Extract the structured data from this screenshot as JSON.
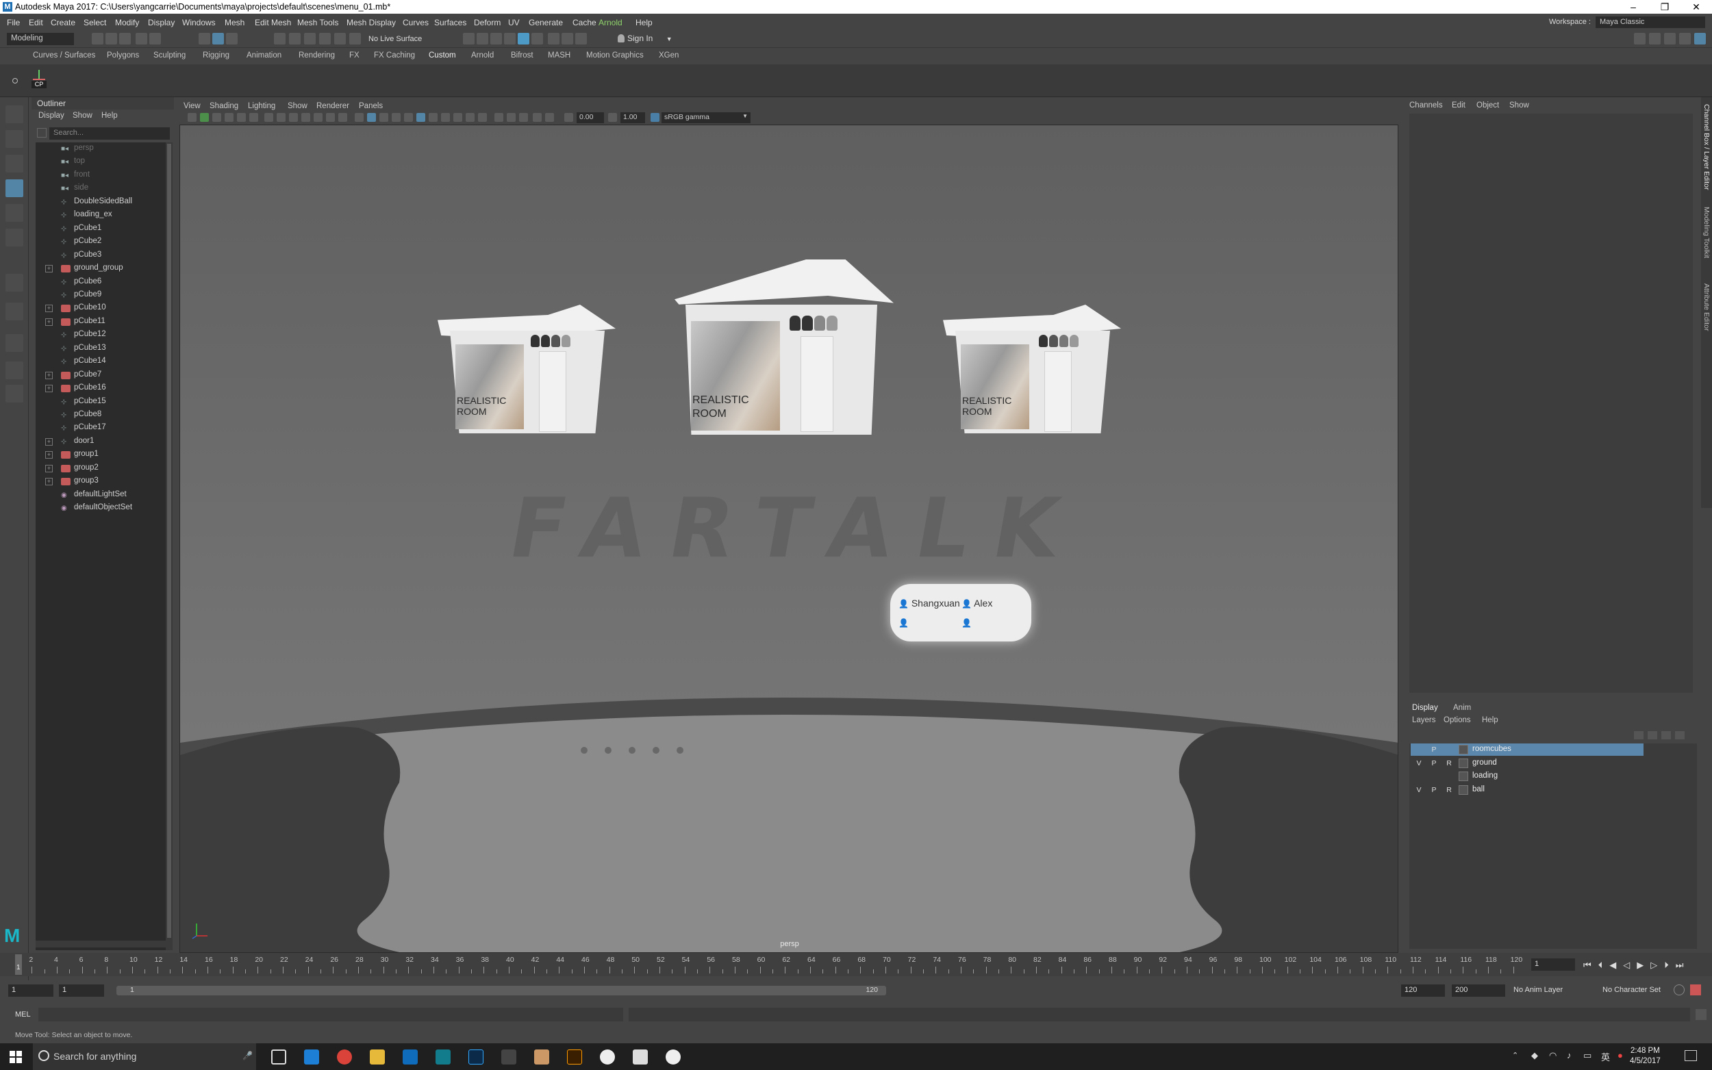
{
  "window": {
    "title": "Autodesk Maya 2017: C:\\Users\\yangcarrie\\Documents\\maya\\projects\\default\\scenes\\menu_01.mb*",
    "controls": [
      "–",
      "❐",
      "✕"
    ]
  },
  "menubar": {
    "items": [
      "File",
      "Edit",
      "Create",
      "Select",
      "Modify",
      "Display",
      "Windows",
      "Mesh",
      "Edit Mesh",
      "Mesh Tools",
      "Mesh Display",
      "Curves",
      "Surfaces",
      "Deform",
      "UV",
      "Generate",
      "Cache",
      "Arnold",
      "Help"
    ],
    "workspace_label": "Workspace :",
    "workspace_value": "Maya Classic"
  },
  "statusline": {
    "mode": "Modeling",
    "live_surface": "No Live Surface",
    "sign_in": "Sign In"
  },
  "shelf": {
    "tabs": [
      "Curves / Surfaces",
      "Polygons",
      "Sculpting",
      "Rigging",
      "Animation",
      "Rendering",
      "FX",
      "FX Caching",
      "Custom",
      "Arnold",
      "Bifrost",
      "MASH",
      "Motion Graphics",
      "XGen"
    ],
    "active_tab": "Custom",
    "button_label": "CP"
  },
  "outliner": {
    "title": "Outliner",
    "menu": [
      "Display",
      "Show",
      "Help"
    ],
    "search_placeholder": "Search...",
    "items": [
      {
        "label": "persp",
        "type": "camera",
        "expand": false
      },
      {
        "label": "top",
        "type": "camera",
        "expand": false
      },
      {
        "label": "front",
        "type": "camera",
        "expand": false
      },
      {
        "label": "side",
        "type": "camera",
        "expand": false
      },
      {
        "label": "DoubleSidedBall",
        "type": "mesh",
        "expand": false
      },
      {
        "label": "loading_ex",
        "type": "mesh",
        "expand": false
      },
      {
        "label": "pCube1",
        "type": "mesh",
        "expand": false
      },
      {
        "label": "pCube2",
        "type": "mesh",
        "expand": false
      },
      {
        "label": "pCube3",
        "type": "mesh",
        "expand": false
      },
      {
        "label": "ground_group",
        "type": "group",
        "expand": true
      },
      {
        "label": "pCube6",
        "type": "mesh",
        "expand": false
      },
      {
        "label": "pCube9",
        "type": "mesh",
        "expand": false
      },
      {
        "label": "pCube10",
        "type": "group",
        "expand": true
      },
      {
        "label": "pCube11",
        "type": "group",
        "expand": true
      },
      {
        "label": "pCube12",
        "type": "mesh",
        "expand": false
      },
      {
        "label": "pCube13",
        "type": "mesh",
        "expand": false
      },
      {
        "label": "pCube14",
        "type": "mesh",
        "expand": false
      },
      {
        "label": "pCube7",
        "type": "group",
        "expand": true
      },
      {
        "label": "pCube16",
        "type": "group",
        "expand": true
      },
      {
        "label": "pCube15",
        "type": "mesh",
        "expand": false
      },
      {
        "label": "pCube8",
        "type": "mesh",
        "expand": false
      },
      {
        "label": "pCube17",
        "type": "mesh",
        "expand": false
      },
      {
        "label": "door1",
        "type": "mesh",
        "expand": true
      },
      {
        "label": "group1",
        "type": "group",
        "expand": true
      },
      {
        "label": "group2",
        "type": "group",
        "expand": true
      },
      {
        "label": "group3",
        "type": "group",
        "expand": true
      },
      {
        "label": "defaultLightSet",
        "type": "set",
        "expand": false
      },
      {
        "label": "defaultObjectSet",
        "type": "set",
        "expand": false
      }
    ]
  },
  "viewport": {
    "menu": [
      "View",
      "Shading",
      "Lighting",
      "Show",
      "Renderer",
      "Panels"
    ],
    "exposure": "0.00",
    "gamma": "1.00",
    "color_space": "sRGB gamma",
    "camera_label": "persp",
    "scene": {
      "room_label_line1": "REALISTIC",
      "room_label_line2": "ROOM",
      "users": [
        "Shangxuan",
        "Alex"
      ],
      "logo": "FARTALK"
    }
  },
  "channelbox": {
    "menu": [
      "Channels",
      "Edit",
      "Object",
      "Show"
    ],
    "side_tabs": [
      "Channel Box / Layer Editor",
      "Modeling Toolkit",
      "Attribute Editor"
    ]
  },
  "layer_editor": {
    "tabs": [
      "Display",
      "Anim"
    ],
    "menu": [
      "Layers",
      "Options",
      "Help"
    ],
    "layers": [
      {
        "name": "roomcubes",
        "v": "",
        "p": "P",
        "r": "",
        "selected": true
      },
      {
        "name": "ground",
        "v": "V",
        "p": "P",
        "r": "R",
        "selected": false
      },
      {
        "name": "loading",
        "v": "",
        "p": "",
        "r": "",
        "selected": false
      },
      {
        "name": "ball",
        "v": "V",
        "p": "P",
        "r": "R",
        "selected": false
      }
    ]
  },
  "timeline": {
    "first_tick": "1",
    "tick_labels": [
      "2",
      "4",
      "6",
      "8",
      "10",
      "12",
      "14",
      "16",
      "18",
      "20",
      "22",
      "24",
      "26",
      "28",
      "30",
      "32",
      "34",
      "36",
      "38",
      "40",
      "42",
      "44",
      "46",
      "48",
      "50",
      "52",
      "54",
      "56",
      "58",
      "60",
      "62",
      "64",
      "66",
      "68",
      "70",
      "72",
      "74",
      "76",
      "78",
      "80",
      "82",
      "84",
      "86",
      "88",
      "90",
      "92",
      "94",
      "96",
      "98",
      "100",
      "102",
      "104",
      "106",
      "108",
      "110",
      "112",
      "114",
      "116",
      "118",
      "120"
    ],
    "current_frame": "1"
  },
  "range": {
    "start": "1",
    "playback_start": "1",
    "slider_start": "1",
    "slider_end": "120",
    "playback_end": "120",
    "end": "200",
    "anim_layer": "No Anim Layer",
    "character_set": "No Character Set"
  },
  "commandline": {
    "label": "MEL"
  },
  "helpline": {
    "text": "Move Tool: Select an object to move."
  },
  "taskbar": {
    "search": "Search for anything",
    "time": "2:48 PM",
    "date": "4/5/2017",
    "tray_lang": "英"
  }
}
